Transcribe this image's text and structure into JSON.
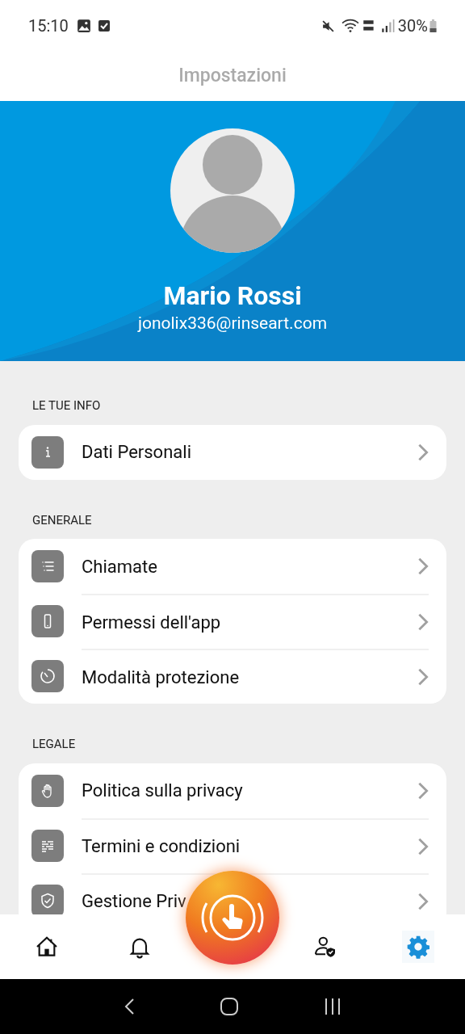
{
  "status_bar": {
    "time": "15:10",
    "battery": "30%"
  },
  "title": "Impostazioni",
  "profile": {
    "name": "Mario Rossi",
    "email": "jonolix336@rinseart.com"
  },
  "sections": [
    {
      "title": "LE TUE INFO",
      "items": [
        {
          "label": "Dati Personali",
          "kind": "info"
        }
      ]
    },
    {
      "title": "GENERALE",
      "items": [
        {
          "label": "Chiamate",
          "kind": "list"
        },
        {
          "label": "Permessi dell'app",
          "kind": "phone"
        },
        {
          "label": "Modalità protezione",
          "kind": "timer"
        }
      ]
    },
    {
      "title": "LEGALE",
      "items": [
        {
          "label": "Politica sulla privacy",
          "kind": "hand"
        },
        {
          "label": "Termini e condizioni",
          "kind": "doc"
        },
        {
          "label": "Gestione Priv",
          "kind": "shield"
        }
      ]
    }
  ],
  "bottom_nav": [
    {
      "kind": "home",
      "selected": false
    },
    {
      "kind": "bell",
      "selected": false
    },
    {
      "kind": "user",
      "selected": false
    },
    {
      "kind": "gear",
      "selected": true
    }
  ]
}
